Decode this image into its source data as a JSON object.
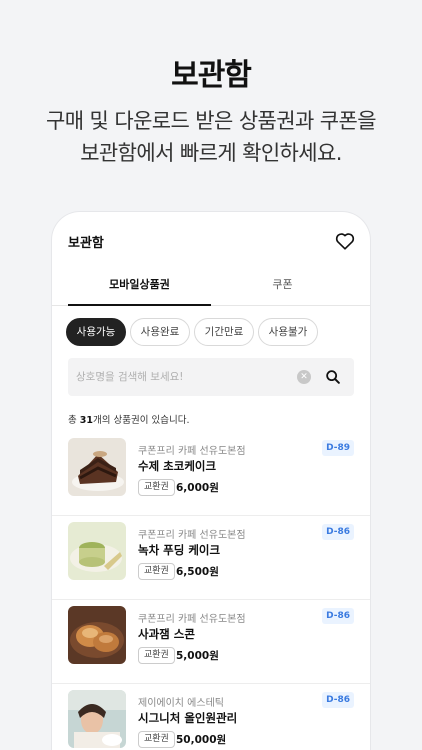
{
  "hero": {
    "title": "보관함",
    "subtitle_line1": "구매 및 다운로드 받은 상품권과 쿠폰을",
    "subtitle_line2": "보관함에서 빠르게 확인하세요."
  },
  "appbar": {
    "title": "보관함",
    "icon": "heart-icon"
  },
  "tabs": [
    {
      "label": "모바일상품권",
      "active": true
    },
    {
      "label": "쿠폰",
      "active": false
    }
  ],
  "filters": [
    {
      "label": "사용가능",
      "active": true
    },
    {
      "label": "사용완료",
      "active": false
    },
    {
      "label": "기간만료",
      "active": false
    },
    {
      "label": "사용불가",
      "active": false
    }
  ],
  "search": {
    "placeholder": "상호명을 검색해 보세요!",
    "value": ""
  },
  "summary": {
    "prefix": "총 ",
    "count": "31",
    "suffix": "개의 상품권이 있습니다."
  },
  "items": [
    {
      "store": "쿠폰프리 카페 선유도본점",
      "name": "수제 초코케이크",
      "type": "교환권",
      "price": "6,000원",
      "dday": "D-89",
      "thumb": "chocolate-cake"
    },
    {
      "store": "쿠폰프리 카페 선유도본점",
      "name": "녹차 푸딩 케이크",
      "type": "교환권",
      "price": "6,500원",
      "dday": "D-86",
      "thumb": "greentea-pudding"
    },
    {
      "store": "쿠폰프리 카페 선유도본점",
      "name": "사과잼 스콘",
      "type": "교환권",
      "price": "5,000원",
      "dday": "D-86",
      "thumb": "apple-scone"
    },
    {
      "store": "제이에이치 에스테틱",
      "name": "시그니처 올인원관리",
      "type": "교환권",
      "price": "50,000원",
      "dday": "D-86",
      "thumb": "spa-treatment"
    }
  ],
  "colors": {
    "accent": "#3b7be0",
    "dday_bg": "#eaf3ff",
    "active_chip": "#222222",
    "page_bg": "#f3f4f6"
  }
}
